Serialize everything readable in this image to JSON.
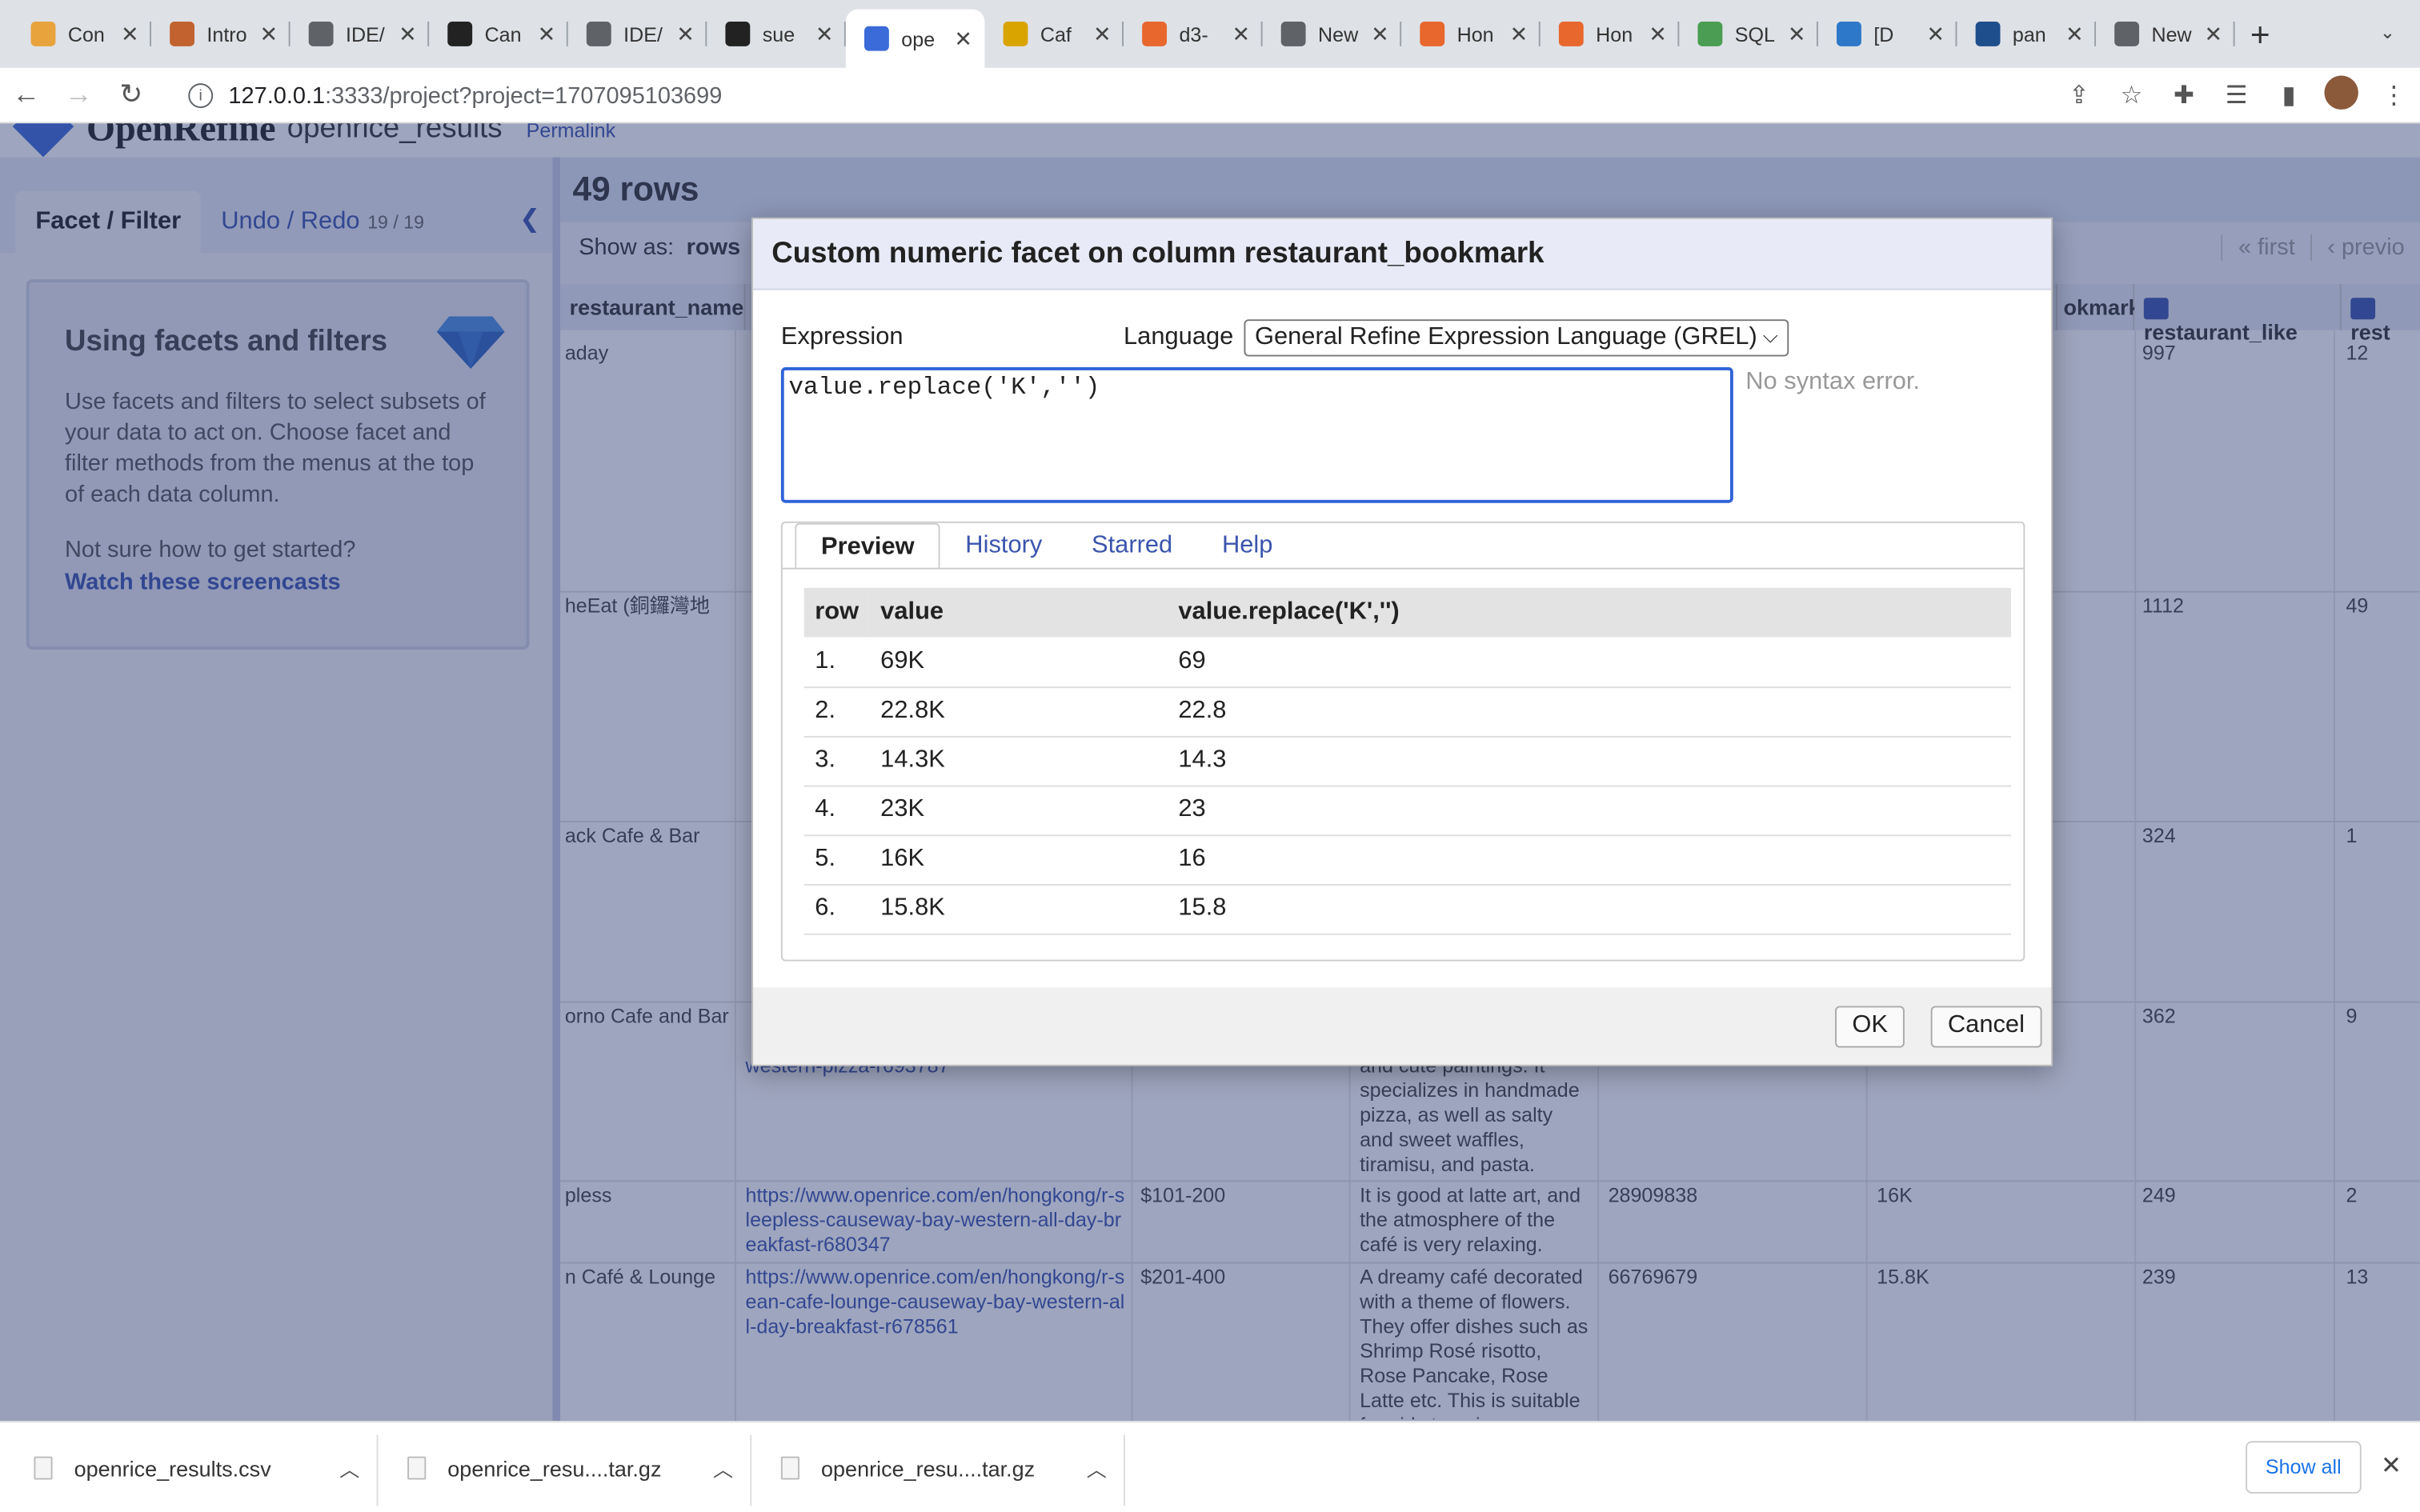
{
  "browser": {
    "tabs": [
      {
        "title": "Con",
        "icon": "note-icon",
        "color": "#e8a33d",
        "active": false
      },
      {
        "title": "Intro",
        "icon": "noodle-icon",
        "color": "#c1622f",
        "active": false
      },
      {
        "title": "IDE/",
        "icon": "globe-icon",
        "color": "#5f6368",
        "active": false
      },
      {
        "title": "Can",
        "icon": "github-icon",
        "color": "#222222",
        "active": false
      },
      {
        "title": "IDE/",
        "icon": "globe-icon",
        "color": "#5f6368",
        "active": false
      },
      {
        "title": "sue",
        "icon": "github-icon",
        "color": "#222222",
        "active": false
      },
      {
        "title": "ope",
        "icon": "diamond-icon",
        "color": "#3b6bd8",
        "active": true
      },
      {
        "title": "Caf",
        "icon": "cafe-icon",
        "color": "#d9a400",
        "active": false
      },
      {
        "title": "d3-",
        "icon": "blogger-icon",
        "color": "#e8672d",
        "active": false
      },
      {
        "title": "New",
        "icon": "chrome-icon",
        "color": "#5f6368",
        "active": false
      },
      {
        "title": "Hon",
        "icon": "openrice-icon",
        "color": "#e8672d",
        "active": false
      },
      {
        "title": "Hon",
        "icon": "openrice-icon",
        "color": "#e8672d",
        "active": false
      },
      {
        "title": "SQL",
        "icon": "sql-icon",
        "color": "#4a9d52",
        "active": false
      },
      {
        "title": "[D",
        "icon": "dataset-icon",
        "color": "#2d78c8",
        "active": false
      },
      {
        "title": "pan",
        "icon": "pandas-icon",
        "color": "#1f4e8c",
        "active": false
      },
      {
        "title": "New",
        "icon": "chrome-icon",
        "color": "#5f6368",
        "active": false
      }
    ],
    "url_host": "127.0.0.1",
    "url_path": ":3333/project?project=1707095103699"
  },
  "app": {
    "brand": "OpenRefine",
    "project_name": "openrice_results",
    "permalink": "Permalink",
    "left_tabs": {
      "facet": "Facet / Filter",
      "undo": "Undo / Redo",
      "undo_count": "19 / 19"
    },
    "help": {
      "title": "Using facets and filters",
      "body": "Use facets and filters to select subsets of your data to act on. Choose facet and filter methods from the menus at the top of each data column.",
      "question": "Not sure how to get started?",
      "link": "Watch these screencasts"
    },
    "row_count": "49 rows",
    "show_as_label": "Show as:",
    "show_as_value": "rows",
    "pager": [
      "« first",
      "‹ previo"
    ],
    "columns": {
      "name": "restaurant_name",
      "bookmark": "okmark",
      "like": "restaurant_like",
      "rest": "rest"
    },
    "rows": [
      {
        "name": "aday",
        "like": "997",
        "rest": "12"
      },
      {
        "name": "heEat (銅鑼灣地",
        "like": "1112",
        "rest": "49"
      },
      {
        "name": "ack Cafe & Bar",
        "like": "324",
        "rest": "1"
      },
      {
        "name": "orno Cafe and Bar",
        "url_tail": "western-pizza-r693787",
        "desc": "and cute paintings. It specializes in handmade pizza, as well as salty and sweet waffles, tiramisu, and pasta.",
        "like": "362",
        "rest": "9"
      },
      {
        "name": "pless",
        "url": "https://www.openrice.com/en/hongkong/r-sleepless-causeway-bay-western-all-day-breakfast-r680347",
        "price": "$101-200",
        "desc": "It is good at latte art, and the atmosphere of the café is very relaxing.",
        "id": "28909838",
        "bookmark": "16K",
        "like": "249",
        "rest": "2"
      },
      {
        "name": "n Café & Lounge",
        "url": "https://www.openrice.com/en/hongkong/r-sean-cafe-lounge-causeway-bay-western-all-day-breakfast-r678561",
        "price": "$201-400",
        "desc": "A dreamy café decorated with a theme of flowers. They offer dishes such as Shrimp Rosé risotto, Rose Pancake, Rose Latte etc. This is suitable for girls to enjoy a",
        "id": "66769679",
        "bookmark": "15.8K",
        "like": "239",
        "rest": "13"
      }
    ]
  },
  "dialog": {
    "title": "Custom numeric facet on column restaurant_bookmark",
    "expression_label": "Expression",
    "language_label": "Language",
    "language_value": "General Refine Expression Language (GREL)",
    "expression": "value.replace('K','')",
    "syntax_status": "No syntax error.",
    "tabs": [
      "Preview",
      "History",
      "Starred",
      "Help"
    ],
    "preview_headers": [
      "row",
      "value",
      "value.replace('K','')"
    ],
    "preview_rows": [
      [
        "1.",
        "69K",
        "69"
      ],
      [
        "2.",
        "22.8K",
        "22.8"
      ],
      [
        "3.",
        "14.3K",
        "14.3"
      ],
      [
        "4.",
        "23K",
        "23"
      ],
      [
        "5.",
        "16K",
        "16"
      ],
      [
        "6.",
        "15.8K",
        "15.8"
      ]
    ],
    "ok": "OK",
    "cancel": "Cancel"
  },
  "downloads": {
    "items": [
      "openrice_results.csv",
      "openrice_resu....tar.gz",
      "openrice_resu....tar.gz"
    ],
    "show_all": "Show all"
  }
}
